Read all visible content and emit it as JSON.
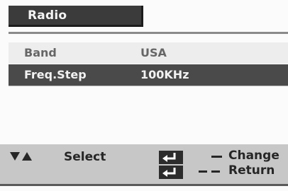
{
  "title": "Radio",
  "menu": {
    "rows": [
      {
        "label": "Band",
        "value": "USA",
        "selected": false
      },
      {
        "label": "Freq.Step",
        "value": "100KHz",
        "selected": true
      }
    ]
  },
  "help": {
    "select_label": "Select",
    "change_label": "Change",
    "return_label": "Return",
    "icons": [
      "down-up-arrows-icon",
      "enter-key-icon"
    ]
  },
  "colors": {
    "title_bg": "#3b3b3b",
    "selected_row_bg": "#4a4a4a",
    "row_bg": "#ededed",
    "help_bar_bg": "#c7c7c7"
  }
}
